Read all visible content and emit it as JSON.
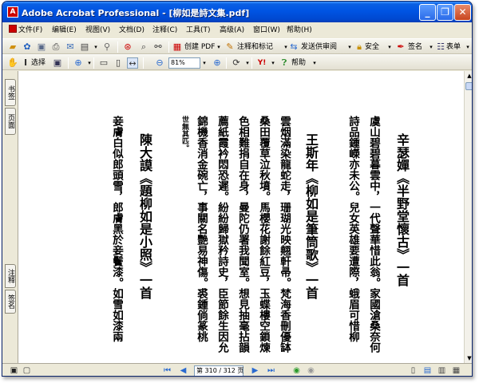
{
  "titlebar": {
    "app_icon": "A",
    "title": "Adobe Acrobat Professional - [柳如是詩文集.pdf]",
    "minimize_glyph": "_",
    "restore_glyph": "❐",
    "close_glyph": "✕"
  },
  "menubar": {
    "items": [
      {
        "label": "文件(F)",
        "icon": "pdf-icon"
      },
      {
        "label": "编辑(E)"
      },
      {
        "label": "视图(V)"
      },
      {
        "label": "文档(D)"
      },
      {
        "label": "注释(C)"
      },
      {
        "label": "工具(T)"
      },
      {
        "label": "高级(A)"
      },
      {
        "label": "窗口(W)"
      },
      {
        "label": "帮助(H)"
      }
    ]
  },
  "toolbar1": {
    "create_pdf": "创建 PDF",
    "comment_markup": "注释和标记",
    "send_review": "发送供审阅",
    "security": "安全",
    "sign": "签名",
    "forms": "表单"
  },
  "toolbar2": {
    "select_label": "选择",
    "zoom_value": "81%",
    "help_label": "帮助"
  },
  "left_tabs": {
    "bookmarks": "书签",
    "pages": "页面",
    "comments": "注释",
    "signatures": "签名"
  },
  "document": {
    "columns": [
      {
        "style": "title",
        "text": "辛瑟嬋《半野堂懷古》一首"
      },
      {
        "style": "body",
        "text": "虞山碧碧暮雲中，一代聲華惜此翁。家國滄桑奈何"
      },
      {
        "style": "body",
        "text": "詩品鍾嶸亦未公。兒女英雄要遭際，蛾眉可惜柳"
      },
      {
        "style": "title",
        "text": "王斯年《柳如是筆筒歌》一首"
      },
      {
        "style": "body",
        "text": "雲烟滿染龍蛇走，珊瑚光映翹軒帚。梵海香刪優缽"
      },
      {
        "style": "body",
        "text": "桑田覆草泣秋墳。馬櫻花謝餘紅豆，玉蝶樓空鎖煉"
      },
      {
        "style": "body",
        "text": "色相難捐自在身，曼陀仍署我聞室。想見抽毫拈韻"
      },
      {
        "style": "body",
        "text": "薦紙霞衿悶恐遲。紛紛歸獄矜詩史，臣節餘生因允"
      },
      {
        "style": "body",
        "text": "錦機香消金碗亡，事關名艷易神傷。裘鍾倘篆桃"
      },
      {
        "style": "note",
        "text": "世無其匹。"
      },
      {
        "style": "title",
        "text": "陳大謨《題柳如是小照》一首"
      },
      {
        "style": "body",
        "text": "妾膚白似郎頭雪，郎膚黑於妾鬢漆。如雪如漆兩"
      }
    ]
  },
  "statusbar": {
    "page_indicator": "第 310 / 312 页"
  },
  "colors": {
    "titlebar": "#0054e3",
    "chrome": "#ece9d8",
    "document_bg": "#ffffff"
  }
}
